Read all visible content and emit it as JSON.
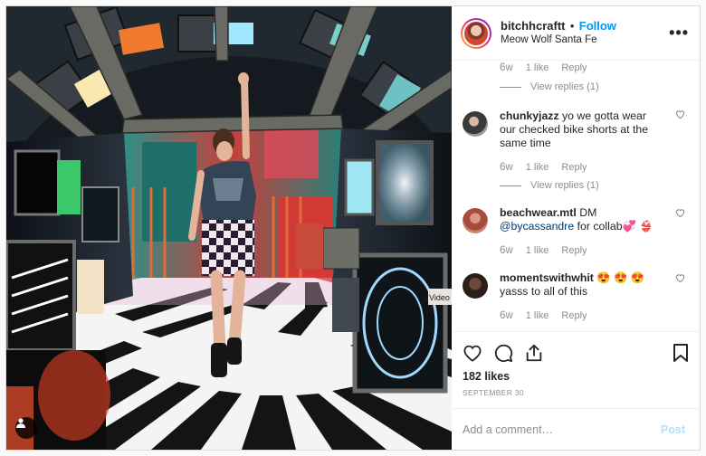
{
  "header": {
    "username": "bitchhcraftt",
    "separator": "•",
    "follow_label": "Follow",
    "location": "Meow Wolf Santa Fe",
    "more_label": "•••"
  },
  "top_meta": {
    "time": "6w",
    "likes": "1 like",
    "reply": "Reply",
    "view_replies": "View replies (1)"
  },
  "comments": [
    {
      "username": "chunkyjazz",
      "text": "yo we gotta wear our checked bike shorts at the same time",
      "time": "6w",
      "likes": "1 like",
      "reply": "Reply",
      "view_replies": "View replies (1)"
    },
    {
      "username": "beachwear.mtl",
      "text_before": "DM",
      "mention": "@bycassandre",
      "text_after": "for collab💞 👙",
      "time": "6w",
      "likes": "1 like",
      "reply": "Reply"
    },
    {
      "username": "momentswithwhit",
      "text": "😍 😍 😍  yasss to all of this",
      "time": "6w",
      "likes": "1 like",
      "reply": "Reply"
    }
  ],
  "actions": {
    "likes_count": "182 likes",
    "date": "SEPTEMBER 30"
  },
  "add_comment": {
    "placeholder": "Add a comment…",
    "post_label": "Post"
  },
  "photo": {
    "sign_text": "Video 1"
  },
  "colors": {
    "link_blue": "#0095f6",
    "post_disabled": "#b2dffc",
    "meta_gray": "#8e8e8e"
  }
}
